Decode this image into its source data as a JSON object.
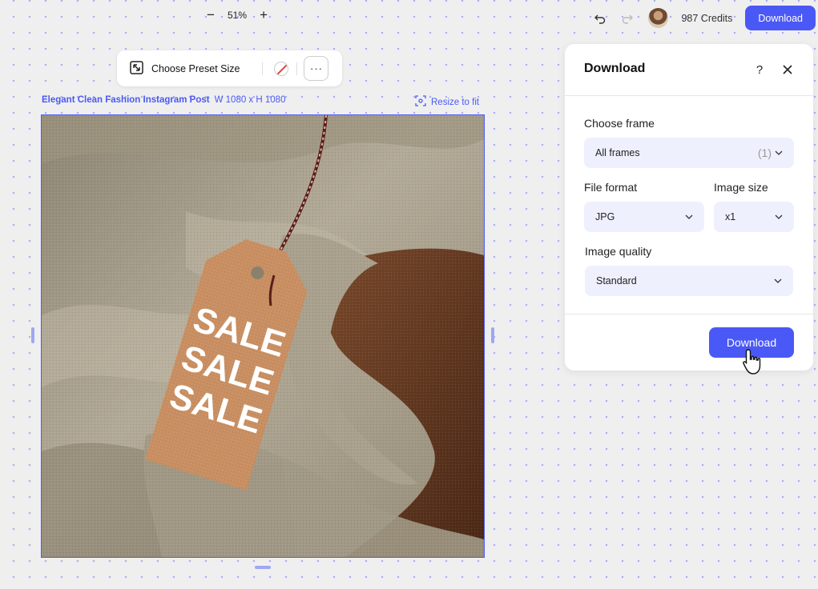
{
  "zoom": {
    "minus": "−",
    "value": "51%",
    "plus": "+"
  },
  "header": {
    "credits": "987 Credits",
    "download_label": "Download"
  },
  "toolbar": {
    "preset_label": "Choose Preset Size",
    "more_label": "···"
  },
  "frame": {
    "name": "Elegant Clean Fashion Instagram Post",
    "size": "W 1080 x H 1080",
    "resize_label": "Resize to fit"
  },
  "tag": {
    "line1": "SALE",
    "line2": "SALE",
    "line3": "SALE"
  },
  "panel": {
    "title": "Download",
    "help": "?",
    "choose_frame_label": "Choose frame",
    "choose_frame_value": "All frames",
    "choose_frame_count": "(1)",
    "file_format_label": "File format",
    "file_format_value": "JPG",
    "image_size_label": "Image size",
    "image_size_value": "x1",
    "image_quality_label": "Image quality",
    "image_quality_value": "Standard",
    "download_label": "Download"
  },
  "colors": {
    "accent": "#4a59f5",
    "select_bg": "#eef0fd",
    "tag": "#c98f62",
    "fabric": "#a49a86",
    "skin": "#6b3f24"
  },
  "icons": [
    "undo-icon",
    "redo-icon",
    "resize-frame-icon",
    "no-color-icon",
    "resize-to-fit-icon",
    "close-icon",
    "chevron-down-icon",
    "hand-cursor-icon"
  ]
}
